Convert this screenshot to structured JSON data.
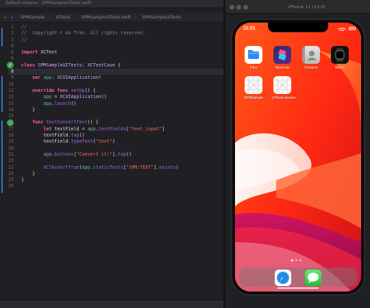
{
  "editor": {
    "window_title": "Default.scheme · SPMSampleUITests.swift",
    "breadcrumbs": [
      "SPMSample",
      "UITests",
      "SPMSampleUITests.swift",
      "SPMSampleUITests"
    ],
    "status_text": "",
    "code_lines": [
      {
        "n": "1",
        "html": "<span class=\"cm\">//</span>"
      },
      {
        "n": "2",
        "html": "<span class=\"cm\">//  Copyright © An Tran. All rights reserved.</span>"
      },
      {
        "n": "3",
        "html": "<span class=\"cm\">//</span>"
      },
      {
        "n": "4",
        "html": ""
      },
      {
        "n": "5",
        "html": "<span class=\"kw\">import</span> XCTest"
      },
      {
        "n": "6",
        "html": ""
      },
      {
        "n": "7",
        "html": "<span class=\"kw\">class</span> <span class=\"ty\">SPMSampleUITests</span>: <span class=\"ty\">XCTestCase</span> {"
      },
      {
        "n": "8",
        "html": "",
        "current": true
      },
      {
        "n": "9",
        "html": "    <span class=\"kw\">var</span> <span class=\"pr\">app</span>: <span class=\"ty\">XCUIApplication</span>!"
      },
      {
        "n": "10",
        "html": ""
      },
      {
        "n": "11",
        "html": "    <span class=\"kw\">override</span> <span class=\"kw\">func</span> <span class=\"nm\">setUp</span>() {"
      },
      {
        "n": "12",
        "html": "        <span class=\"pr\">app</span> = <span class=\"ty\">XCUIApplication</span>()"
      },
      {
        "n": "13",
        "html": "        <span class=\"pr\">app</span>.<span class=\"nm\">launch</span>()"
      },
      {
        "n": "14",
        "html": "    }"
      },
      {
        "n": "15",
        "html": ""
      },
      {
        "n": "16",
        "html": "    <span class=\"kw\">func</span> <span class=\"nm\">testConvertText</span>() {"
      },
      {
        "n": "17",
        "html": "        <span class=\"kw\">let</span> textField = <span class=\"pr\">app</span>.<span class=\"nm\">textFields</span>[<span class=\"st\">\"text_input\"</span>]"
      },
      {
        "n": "18",
        "html": "        textField.<span class=\"nm\">tap</span>()"
      },
      {
        "n": "19",
        "html": "        textField.<span class=\"nm\">typeText</span>(<span class=\"st\">\"text\"</span>)"
      },
      {
        "n": "20",
        "html": ""
      },
      {
        "n": "21",
        "html": "        <span class=\"pr\">app</span>.<span class=\"nm\">buttons</span>[<span class=\"st\">\"Convert it!\"</span>].<span class=\"nm\">tap</span>()"
      },
      {
        "n": "22",
        "html": ""
      },
      {
        "n": "23",
        "html": "        <span class=\"nm\">XCTAssertTrue</span>(<span class=\"pr\">app</span>.<span class=\"nm\">staticTexts</span>[<span class=\"st\">\"SPM:TEXT\"</span>].<span class=\"nm\">exists</span>)"
      },
      {
        "n": "24",
        "html": "    }"
      },
      {
        "n": "25",
        "html": "}"
      },
      {
        "n": "26",
        "html": ""
      }
    ],
    "test_badges": [
      "7",
      "16"
    ]
  },
  "simulator": {
    "window_title": "iPhone 11 (13.0)",
    "time": "11:21",
    "apps_row1": [
      {
        "name": "files-app",
        "label": "Files"
      },
      {
        "name": "shortcuts-app",
        "label": "Shortcuts"
      },
      {
        "name": "contacts-app",
        "label": "Contacts"
      },
      {
        "name": "watch-app",
        "label": "Watch"
      }
    ],
    "apps_row2": [
      {
        "name": "spmsample-app",
        "label": "SPMSample"
      },
      {
        "name": "uitests-runner-app",
        "label": "UITests-Runner"
      }
    ],
    "dock": [
      "safari-icon",
      "messages-icon"
    ]
  },
  "colors": {
    "editor_bg": "#1f1f24",
    "keyword": "#fc5fa3",
    "string": "#fc6a5d",
    "comment": "#7a8a8f",
    "test_pass": "#3aa84a",
    "wallpaper": "#ff3b13"
  }
}
